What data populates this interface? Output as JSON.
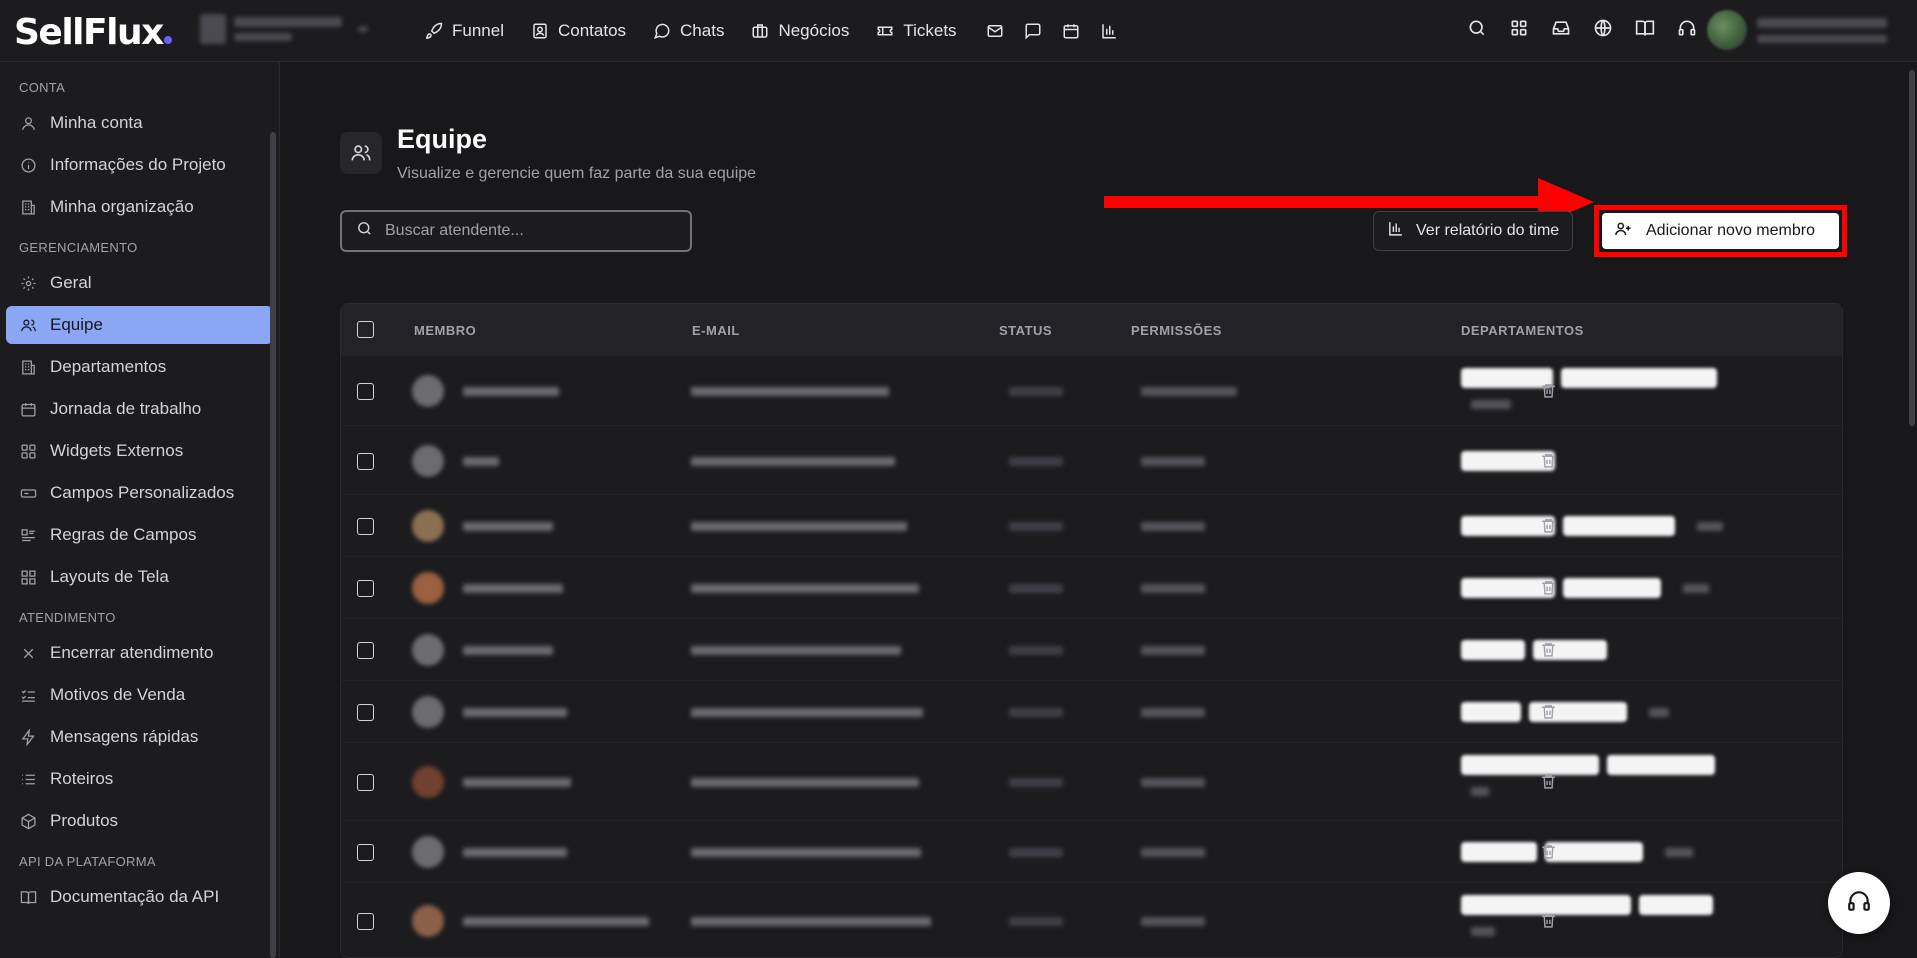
{
  "brand": {
    "logo_text": "SellFlux"
  },
  "topnav": {
    "items": [
      {
        "label": "Funnel",
        "icon": "rocket-icon"
      },
      {
        "label": "Contatos",
        "icon": "contact-card-icon"
      },
      {
        "label": "Chats",
        "icon": "chat-bubble-icon"
      },
      {
        "label": "Negócios",
        "icon": "briefcase-icon"
      },
      {
        "label": "Tickets",
        "icon": "ticket-icon"
      }
    ],
    "icon_only": [
      "mail-icon",
      "message-square-icon",
      "calendar-icon",
      "bar-chart-icon"
    ],
    "right_icons": [
      "search-icon",
      "apps-grid-icon",
      "inbox-icon",
      "globe-icon",
      "book-icon",
      "headset-icon"
    ]
  },
  "sidebar": {
    "sections": [
      {
        "title": "CONTA",
        "items": [
          {
            "label": "Minha conta",
            "icon": "user-icon"
          },
          {
            "label": "Informações do Projeto",
            "icon": "info-icon"
          },
          {
            "label": "Minha organização",
            "icon": "building-icon"
          }
        ]
      },
      {
        "title": "GERENCIAMENTO",
        "items": [
          {
            "label": "Geral",
            "icon": "gear-icon"
          },
          {
            "label": "Equipe",
            "icon": "users-icon",
            "active": true
          },
          {
            "label": "Departamentos",
            "icon": "building-icon"
          },
          {
            "label": "Jornada de trabalho",
            "icon": "calendar-icon"
          },
          {
            "label": "Widgets Externos",
            "icon": "widgets-icon"
          },
          {
            "label": "Campos Personalizados",
            "icon": "input-field-icon"
          },
          {
            "label": "Regras de Campos",
            "icon": "rules-icon"
          },
          {
            "label": "Layouts de Tela",
            "icon": "layout-icon"
          }
        ]
      },
      {
        "title": "ATENDIMENTO",
        "items": [
          {
            "label": "Encerrar atendimento",
            "icon": "close-icon"
          },
          {
            "label": "Motivos de Venda",
            "icon": "checklist-icon"
          },
          {
            "label": "Mensagens rápidas",
            "icon": "lightning-icon"
          },
          {
            "label": "Roteiros",
            "icon": "list-icon"
          },
          {
            "label": "Produtos",
            "icon": "box-icon"
          }
        ]
      },
      {
        "title": "API DA PLATAFORMA",
        "items": [
          {
            "label": "Documentação da API",
            "icon": "book-icon"
          }
        ]
      }
    ]
  },
  "page": {
    "title": "Equipe",
    "subtitle": "Visualize e gerencie quem faz parte da sua equipe",
    "search_placeholder": "Buscar atendente...",
    "report_button": "Ver relatório do time",
    "add_button": "Adicionar novo membro"
  },
  "table": {
    "columns": [
      "MEMBRO",
      "E-MAIL",
      "STATUS",
      "PERMISSÕES",
      "DEPARTAMENTOS"
    ],
    "rows": [
      {
        "avatar": "#6b6b70",
        "name_w": 96,
        "email_w": 198,
        "perm_w": 96,
        "depts": [
          92,
          156
        ],
        "extra": 40,
        "two_line": true
      },
      {
        "avatar": "#6b6b70",
        "name_w": 36,
        "email_w": 204,
        "perm_w": 64,
        "depts": [
          94
        ],
        "extra": 0,
        "two_line": false
      },
      {
        "avatar": "#8a7050",
        "name_w": 90,
        "email_w": 216,
        "perm_w": 64,
        "depts": [
          94,
          112
        ],
        "extra": 26,
        "two_line": false
      },
      {
        "avatar": "#9a6040",
        "name_w": 100,
        "email_w": 228,
        "perm_w": 64,
        "depts": [
          94,
          98
        ],
        "extra": 26,
        "two_line": false
      },
      {
        "avatar": "#6b6b70",
        "name_w": 90,
        "email_w": 210,
        "perm_w": 64,
        "depts": [
          64,
          74
        ],
        "extra": 0,
        "two_line": false
      },
      {
        "avatar": "#6b6b70",
        "name_w": 104,
        "email_w": 232,
        "perm_w": 64,
        "depts": [
          60,
          98
        ],
        "extra": 20,
        "two_line": false
      },
      {
        "avatar": "#704030",
        "name_w": 108,
        "email_w": 228,
        "perm_w": 64,
        "depts": [
          138,
          108
        ],
        "extra": 18,
        "two_line": true
      },
      {
        "avatar": "#6b6b70",
        "name_w": 104,
        "email_w": 230,
        "perm_w": 64,
        "depts": [
          76,
          98
        ],
        "extra": 28,
        "two_line": false
      },
      {
        "avatar": "#8a6048",
        "name_w": 186,
        "email_w": 240,
        "perm_w": 64,
        "depts": [
          170,
          74
        ],
        "extra": 24,
        "two_line": true
      }
    ]
  }
}
